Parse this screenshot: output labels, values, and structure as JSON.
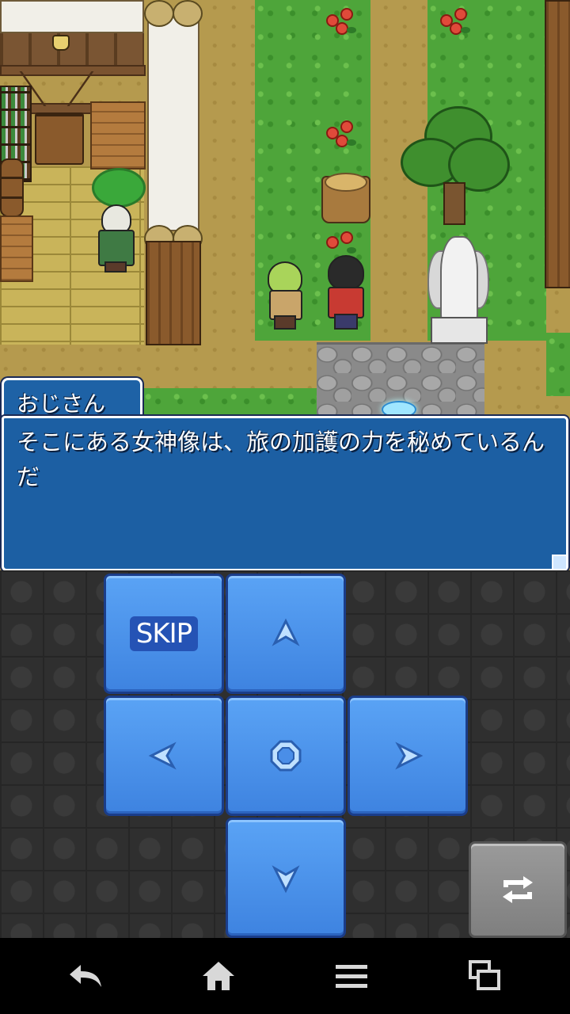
{
  "dialog": {
    "speaker": "おじさん",
    "message": "そこにある女神像は、旅の加護の力を秘めているんだ"
  },
  "controls": {
    "skip_label": "SKIP",
    "buttons": [
      "skip-button",
      "up-button",
      "left-button",
      "confirm-button",
      "right-button",
      "down-button",
      "switch-button"
    ]
  },
  "navbar": {
    "buttons": [
      "back-icon",
      "home-icon",
      "menu-icon",
      "recent-apps-icon"
    ]
  },
  "colors": {
    "dialog_bg": "#1c5fa3",
    "pad_button": "#4a90e8",
    "navbar_bg": "#000000"
  }
}
